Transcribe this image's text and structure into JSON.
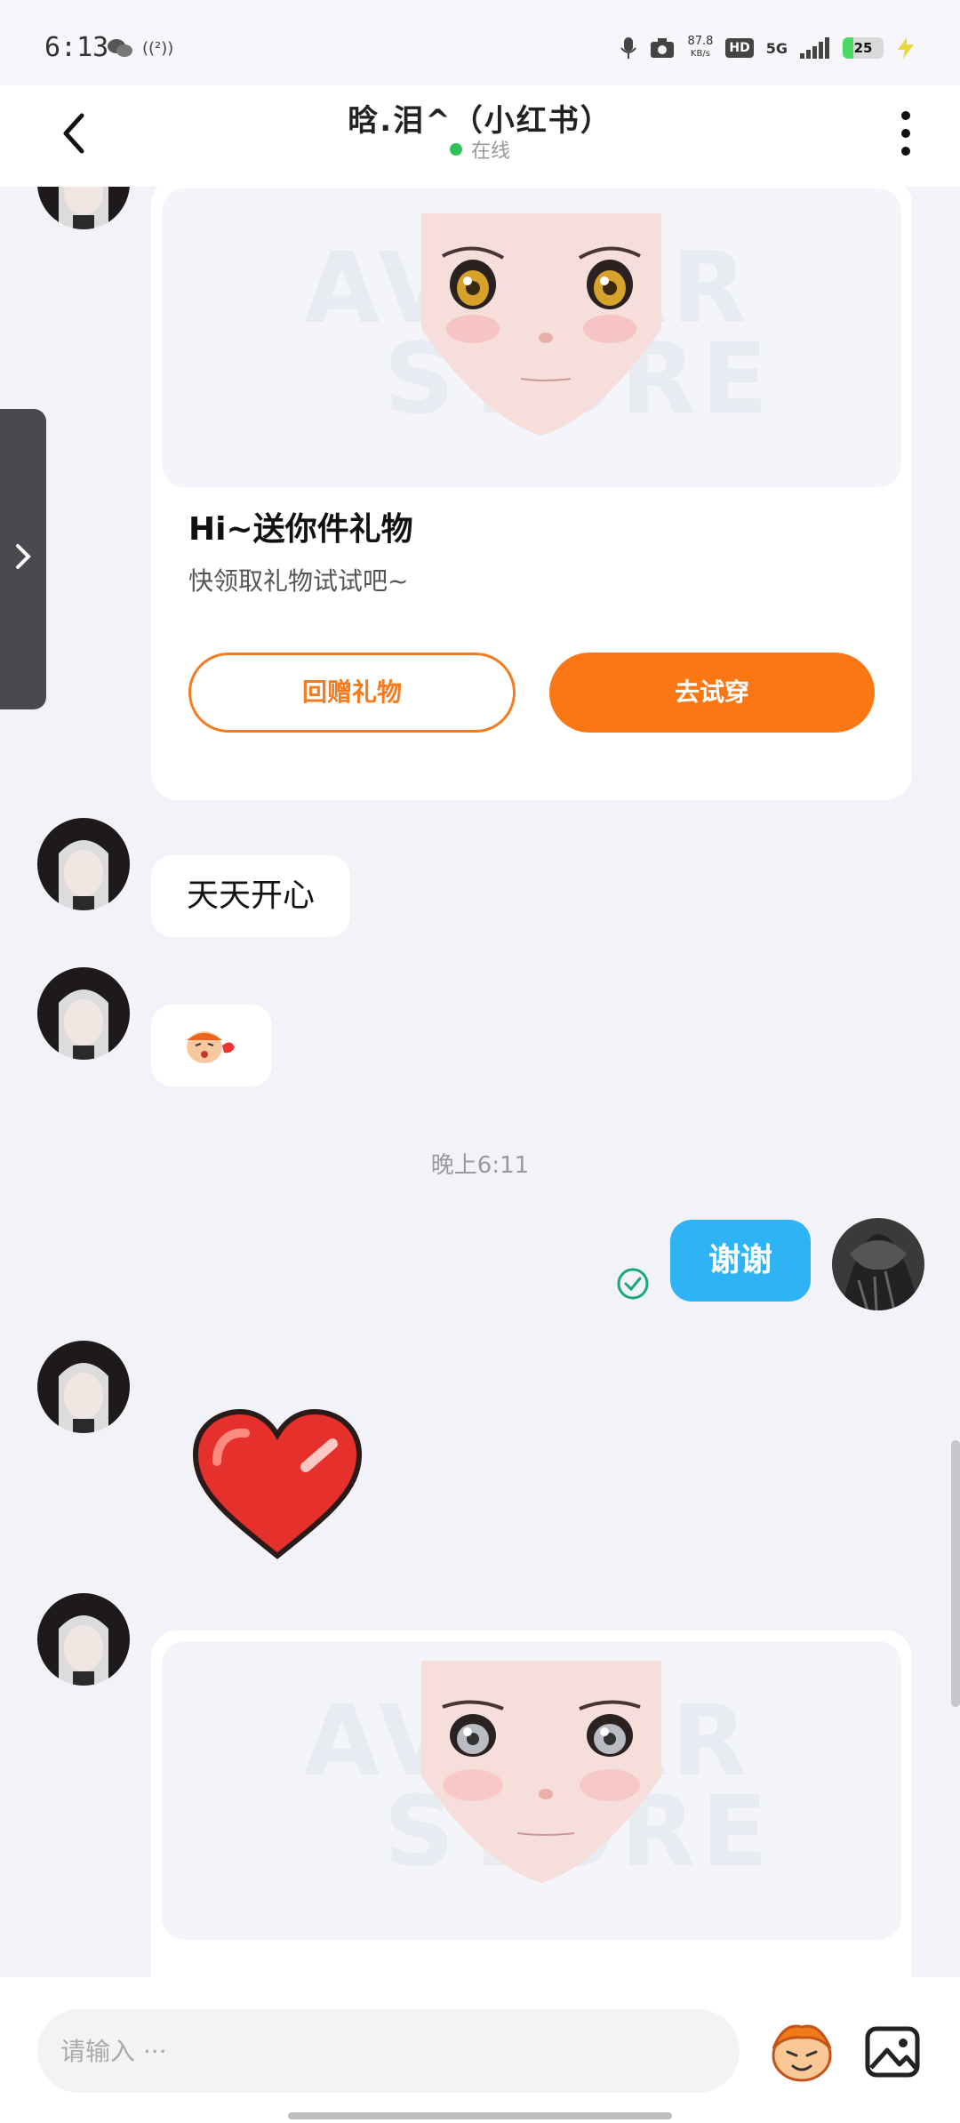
{
  "status_bar": {
    "time": "6:13",
    "hotspot": "((²))",
    "net_speed_value": "87.8",
    "net_speed_unit": "KB/s",
    "hd": "HD",
    "network": "5G",
    "battery": "25",
    "battery_level": 0.25
  },
  "header": {
    "title": "晗.泪^（小红书）",
    "status": "在线"
  },
  "messages": {
    "gift_title": "Hi~送你件礼物",
    "gift_subtitle": "快领取礼物试试吧~",
    "gift_return_label": "回赠礼物",
    "gift_try_label": "去试穿",
    "watermark_top": "AVATAR",
    "watermark_bottom": "STORE",
    "msg_text_1": "天天开心",
    "time_divider": "晚上6:11",
    "msg_out_1": "谢谢"
  },
  "input": {
    "placeholder": "请输入 ···"
  },
  "colors": {
    "accent_orange": "#fb7714",
    "outgoing_bubble": "#2eb4f4",
    "online_green": "#2fc35a"
  },
  "icons": [
    "back-arrow-icon",
    "more-icon",
    "side-panel-chevron-icon",
    "sent-check-icon",
    "emoji-icon",
    "image-icon",
    "heart-sticker-icon"
  ]
}
